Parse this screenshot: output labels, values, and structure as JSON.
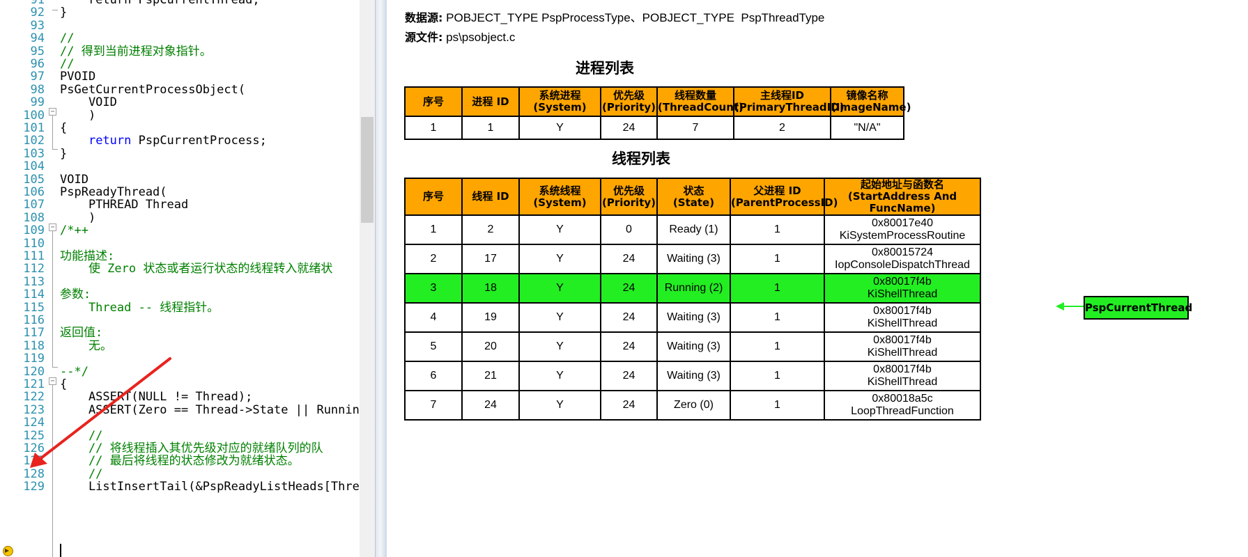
{
  "editor": {
    "lines": [
      {
        "num": "91",
        "text": "    return PspCurrentThread;",
        "cls": ""
      },
      {
        "num": "92",
        "text": "}",
        "cls": ""
      },
      {
        "num": "93",
        "text": "",
        "cls": ""
      },
      {
        "num": "94",
        "text": "//",
        "cls": "cm"
      },
      {
        "num": "95",
        "text": "// 得到当前进程对象指针。",
        "cls": "cm"
      },
      {
        "num": "96",
        "text": "//",
        "cls": "cm"
      },
      {
        "num": "97",
        "text": "PVOID",
        "cls": ""
      },
      {
        "num": "98",
        "text": "PsGetCurrentProcessObject(",
        "cls": ""
      },
      {
        "num": "99",
        "text": "    VOID",
        "cls": ""
      },
      {
        "num": "100",
        "text": "    )",
        "cls": ""
      },
      {
        "num": "101",
        "text": "{",
        "cls": ""
      },
      {
        "num": "102",
        "text": "    return PspCurrentProcess;",
        "cls": "ret"
      },
      {
        "num": "103",
        "text": "}",
        "cls": ""
      },
      {
        "num": "104",
        "text": "",
        "cls": ""
      },
      {
        "num": "105",
        "text": "VOID",
        "cls": ""
      },
      {
        "num": "106",
        "text": "PspReadyThread(",
        "cls": ""
      },
      {
        "num": "107",
        "text": "    PTHREAD Thread",
        "cls": ""
      },
      {
        "num": "108",
        "text": "    )",
        "cls": ""
      },
      {
        "num": "109",
        "text": "/*++",
        "cls": "cm"
      },
      {
        "num": "110",
        "text": "",
        "cls": ""
      },
      {
        "num": "111",
        "text": "功能描述:",
        "cls": "cm"
      },
      {
        "num": "112",
        "text": "    使 Zero 状态或者运行状态的线程转入就绪状",
        "cls": "cm"
      },
      {
        "num": "113",
        "text": "",
        "cls": ""
      },
      {
        "num": "114",
        "text": "参数:",
        "cls": "cm"
      },
      {
        "num": "115",
        "text": "    Thread -- 线程指针。",
        "cls": "cm"
      },
      {
        "num": "116",
        "text": "",
        "cls": ""
      },
      {
        "num": "117",
        "text": "返回值:",
        "cls": "cm"
      },
      {
        "num": "118",
        "text": "    无。",
        "cls": "cm"
      },
      {
        "num": "119",
        "text": "",
        "cls": ""
      },
      {
        "num": "120",
        "text": "--*/",
        "cls": "cm"
      },
      {
        "num": "121",
        "text": "{",
        "cls": ""
      },
      {
        "num": "122",
        "text": "    ASSERT(NULL != Thread);",
        "cls": ""
      },
      {
        "num": "123",
        "text": "    ASSERT(Zero == Thread->State || Running",
        "cls": ""
      },
      {
        "num": "124",
        "text": "",
        "cls": ""
      },
      {
        "num": "125",
        "text": "    //",
        "cls": "cm"
      },
      {
        "num": "126",
        "text": "    // 将线程插入其优先级对应的就绪队列的队",
        "cls": "cm"
      },
      {
        "num": "127",
        "text": "    // 最后将线程的状态修改为就绪状态。",
        "cls": "cm"
      },
      {
        "num": "128",
        "text": "    //",
        "cls": "cm"
      },
      {
        "num": "129",
        "text": "    ListInsertTail(&PspReadyListHeads[Threa",
        "cls": ""
      }
    ]
  },
  "doc": {
    "source_label": "数据源:",
    "source_value": " POBJECT_TYPE PspProcessType、POBJECT_TYPE  PspThreadType",
    "file_label": "源文件:",
    "file_value": " ps\\psobject.c",
    "process_title": "进程列表",
    "thread_title": "线程列表",
    "current_thread_label": "PspCurrentThread",
    "process_table": {
      "headers": [
        [
          "序号"
        ],
        [
          "进程 ID"
        ],
        [
          "系统进程",
          "(System)"
        ],
        [
          "优先级",
          "(Priority)"
        ],
        [
          "线程数量",
          "(ThreadCount)"
        ],
        [
          "主线程ID",
          "(PrimaryThreadID)"
        ],
        [
          "镜像名称",
          "(ImageName)"
        ]
      ],
      "rows": [
        [
          "1",
          "1",
          "Y",
          "24",
          "7",
          "2",
          "\"N/A\""
        ]
      ]
    },
    "thread_table": {
      "headers": [
        [
          "序号"
        ],
        [
          "线程 ID"
        ],
        [
          "系统线程",
          "(System)"
        ],
        [
          "优先级",
          "(Priority)"
        ],
        [
          "状态",
          "(State)"
        ],
        [
          "父进程 ID",
          "(ParentProcessID)"
        ],
        [
          "起始地址与函数名",
          "(StartAddress And FuncName)"
        ]
      ],
      "rows": [
        {
          "cells": [
            "1",
            "2",
            "Y",
            "0",
            "Ready (1)",
            "1"
          ],
          "addr": "0x80017e40",
          "func": "KiSystemProcessRoutine",
          "current": false
        },
        {
          "cells": [
            "2",
            "17",
            "Y",
            "24",
            "Waiting (3)",
            "1"
          ],
          "addr": "0x80015724",
          "func": "IopConsoleDispatchThread",
          "current": false
        },
        {
          "cells": [
            "3",
            "18",
            "Y",
            "24",
            "Running (2)",
            "1"
          ],
          "addr": "0x80017f4b",
          "func": "KiShellThread",
          "current": true
        },
        {
          "cells": [
            "4",
            "19",
            "Y",
            "24",
            "Waiting (3)",
            "1"
          ],
          "addr": "0x80017f4b",
          "func": "KiShellThread",
          "current": false
        },
        {
          "cells": [
            "5",
            "20",
            "Y",
            "24",
            "Waiting (3)",
            "1"
          ],
          "addr": "0x80017f4b",
          "func": "KiShellThread",
          "current": false
        },
        {
          "cells": [
            "6",
            "21",
            "Y",
            "24",
            "Waiting (3)",
            "1"
          ],
          "addr": "0x80017f4b",
          "func": "KiShellThread",
          "current": false
        },
        {
          "cells": [
            "7",
            "24",
            "Y",
            "24",
            "Zero (0)",
            "1"
          ],
          "addr": "0x80018a5c",
          "func": "LoopThreadFunction",
          "current": false
        }
      ]
    }
  },
  "colors": {
    "header_bg": "#ffa500",
    "highlight": "#22ee22",
    "comment": "#008000",
    "keyword": "#0000ff",
    "line_number": "#2b91af",
    "annotation_arrow": "#e8231e"
  }
}
